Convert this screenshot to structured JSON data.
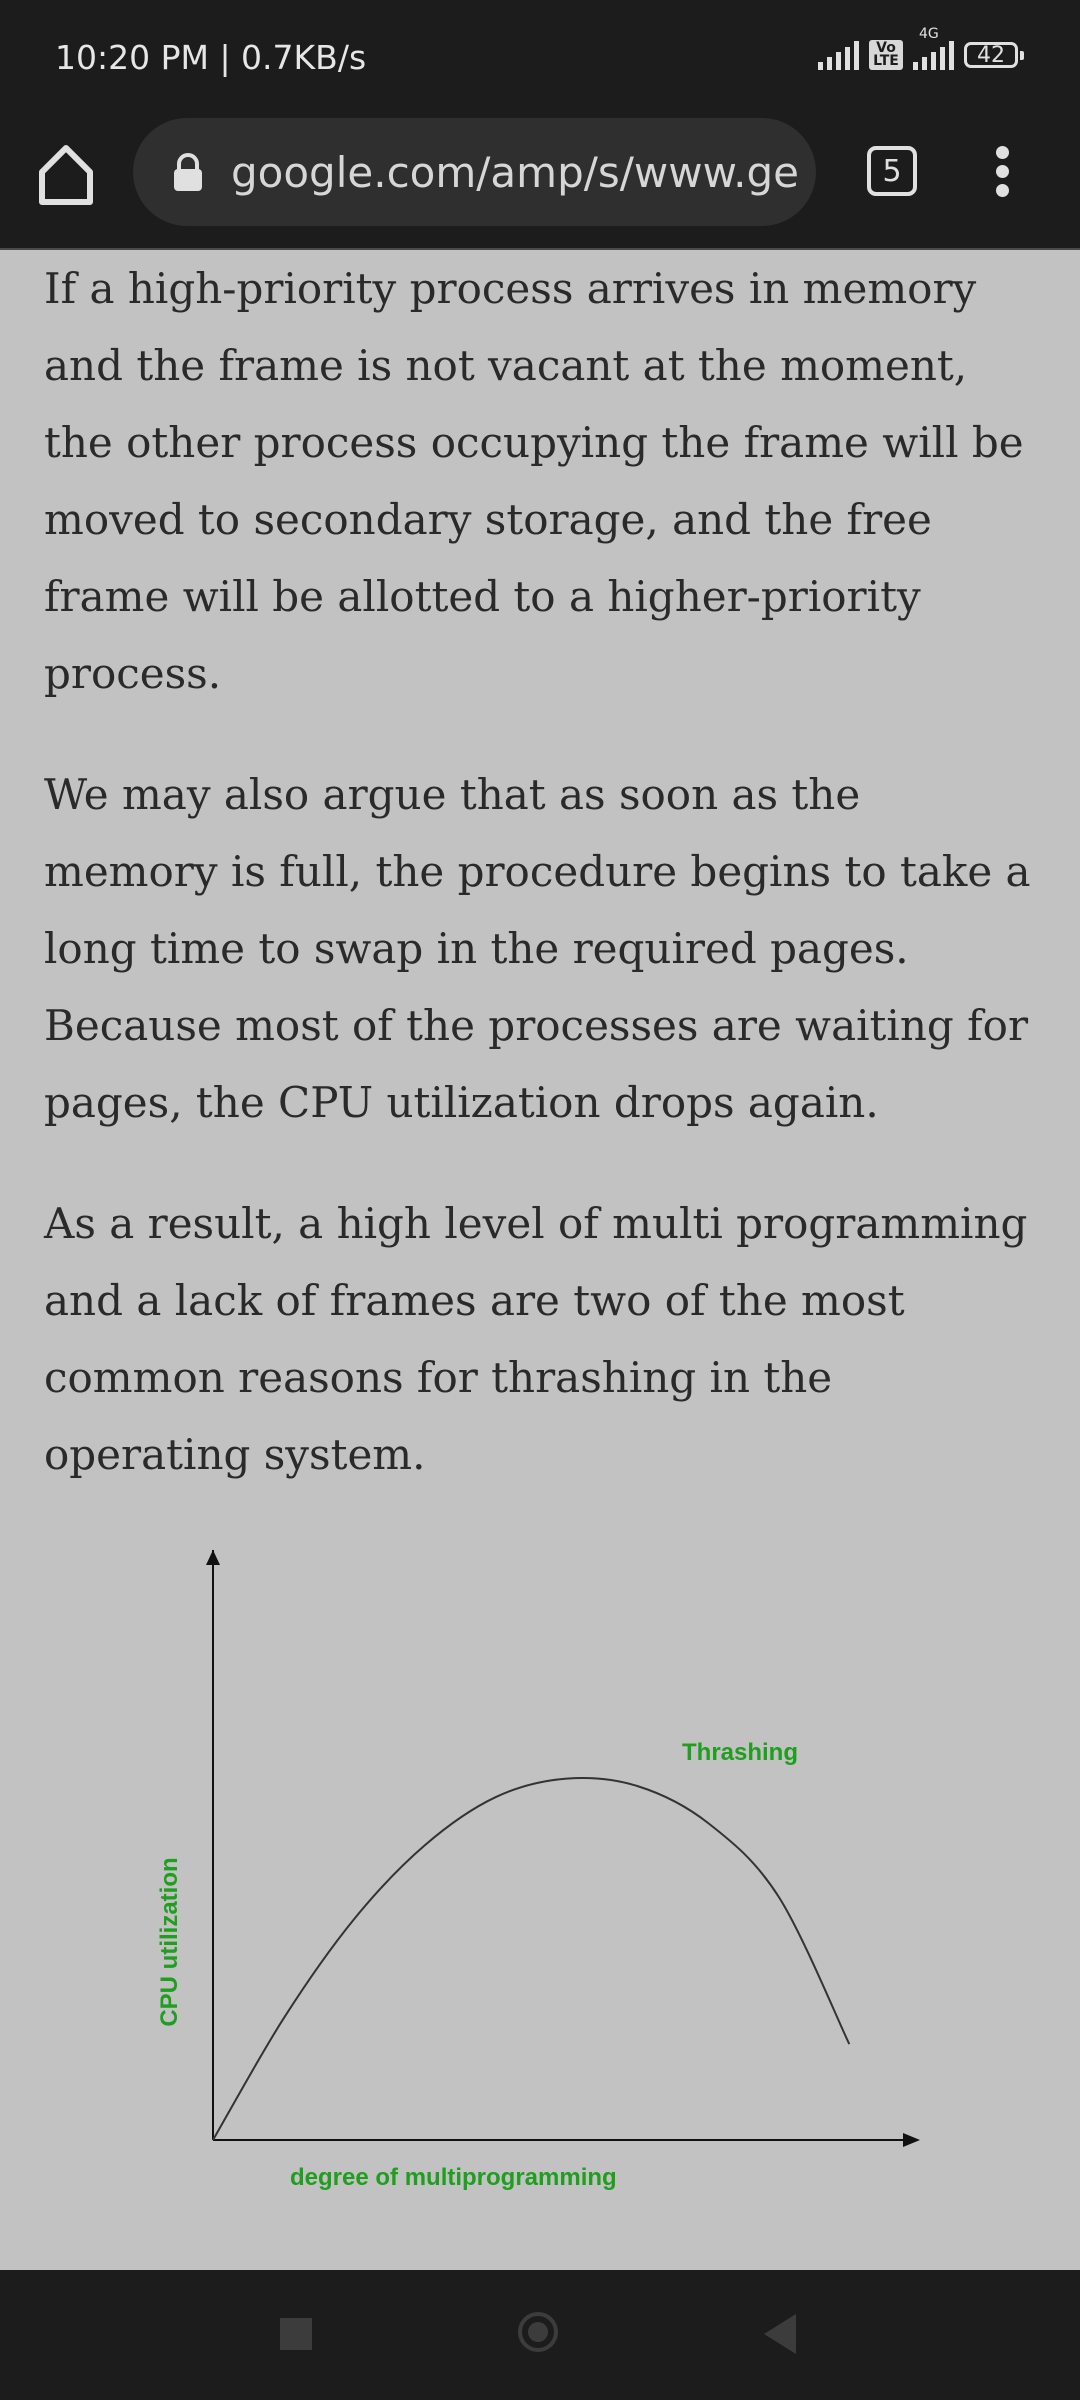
{
  "status_bar": {
    "time": "10:20 PM | 0.7KB/s",
    "volte": "Vo LTE",
    "network": "4G",
    "battery": "42"
  },
  "browser": {
    "url": "google.com/amp/s/www.geeksforgeeks.org",
    "tab_count": "5",
    "icons": [
      "home-icon",
      "lock-icon",
      "tabs-icon",
      "more-vert-icon"
    ]
  },
  "article": {
    "paragraphs": [
      "If a high-priority process arrives in memory and the frame is not vacant at the moment, the other process occupying the frame will be moved to secondary storage, and the free frame will be allotted to a higher-priority process.",
      "We may also argue that as soon as the memory is full, the procedure begins to take a long time to swap in the required pages. Because most of the processes are waiting for pages, the CPU utilization drops again.",
      "As a result, a high level of multi programming and a lack of frames are two of the most common reasons for thrashing in the operating system."
    ]
  },
  "chart_data": {
    "type": "line",
    "title": "",
    "xlabel": "degree of multiprogramming",
    "ylabel": "CPU utilization",
    "annotations": [
      "Thrashing"
    ],
    "label_color": "#1f9e1f",
    "curve_color": "#333333",
    "series": [
      {
        "x": [
          0,
          0.1,
          0.2,
          0.3,
          0.4,
          0.5,
          0.6,
          0.7,
          0.8,
          0.9
        ],
        "y": [
          0,
          0.33,
          0.6,
          0.8,
          0.93,
          0.98,
          0.96,
          0.86,
          0.66,
          0.26
        ]
      }
    ],
    "xlim": [
      0,
      1
    ],
    "ylim": [
      0,
      1.6
    ],
    "grid": false
  },
  "nav_bar": {
    "icons": [
      "recents-icon",
      "home-circle-icon",
      "back-icon"
    ]
  }
}
